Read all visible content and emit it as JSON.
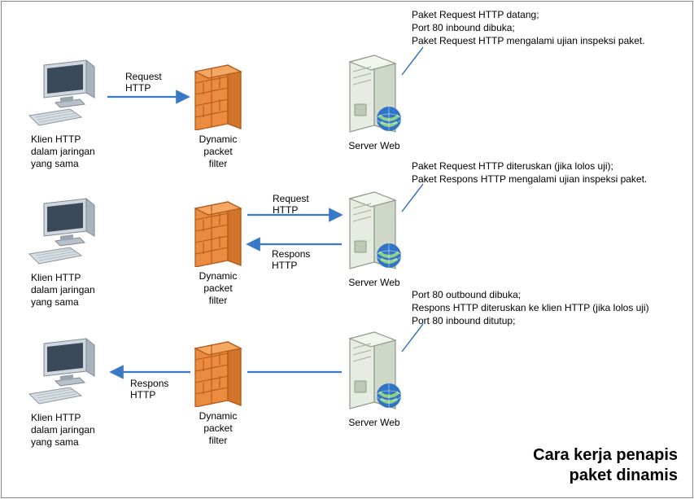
{
  "title_lines": [
    "Cara kerja penapis",
    "paket dinamis"
  ],
  "clients": [
    {
      "label_lines": [
        "Klien HTTP",
        "dalam jaringan",
        "yang sama"
      ]
    },
    {
      "label_lines": [
        "Klien HTTP",
        "dalam jaringan",
        "yang sama"
      ]
    },
    {
      "label_lines": [
        "Klien HTTP",
        "dalam jaringan",
        "yang sama"
      ]
    }
  ],
  "firewalls": [
    {
      "label_lines": [
        "Dynamic",
        "packet",
        "filter"
      ]
    },
    {
      "label_lines": [
        "Dynamic",
        "packet",
        "filter"
      ]
    },
    {
      "label_lines": [
        "Dynamic",
        "packet",
        "filter"
      ]
    }
  ],
  "servers": [
    {
      "label": "Server Web"
    },
    {
      "label": "Server Web"
    },
    {
      "label": "Server Web"
    }
  ],
  "edges": {
    "row1_client_fw": {
      "label_lines": [
        "Request",
        "HTTP"
      ]
    },
    "row2_fw_srv_req": {
      "label_lines": [
        "Request",
        "HTTP"
      ]
    },
    "row2_srv_fw_res": {
      "label_lines": [
        "Respons",
        "HTTP"
      ]
    },
    "row3_fw_client": {
      "label_lines": [
        "Respons",
        "HTTP"
      ]
    }
  },
  "callouts": [
    {
      "lines": [
        "Paket Request HTTP datang;",
        "Port 80 inbound dibuka;",
        "Paket Request HTTP mengalami ujian inspeksi paket."
      ]
    },
    {
      "lines": [
        "Paket Request HTTP diteruskan (jika lolos uji);",
        "Paket Respons HTTP mengalami ujian inspeksi paket."
      ]
    },
    {
      "lines": [
        "Port 80 outbound dibuka;",
        "Respons HTTP diteruskan ke klien HTTP (jika lolos uji)",
        "Port 80 inbound ditutup;"
      ]
    }
  ],
  "colors": {
    "arrow": "#3a79c7",
    "callout_line": "#2b6ab8",
    "firewall_fill": "#ea8b3f",
    "firewall_stroke": "#b45a19"
  }
}
